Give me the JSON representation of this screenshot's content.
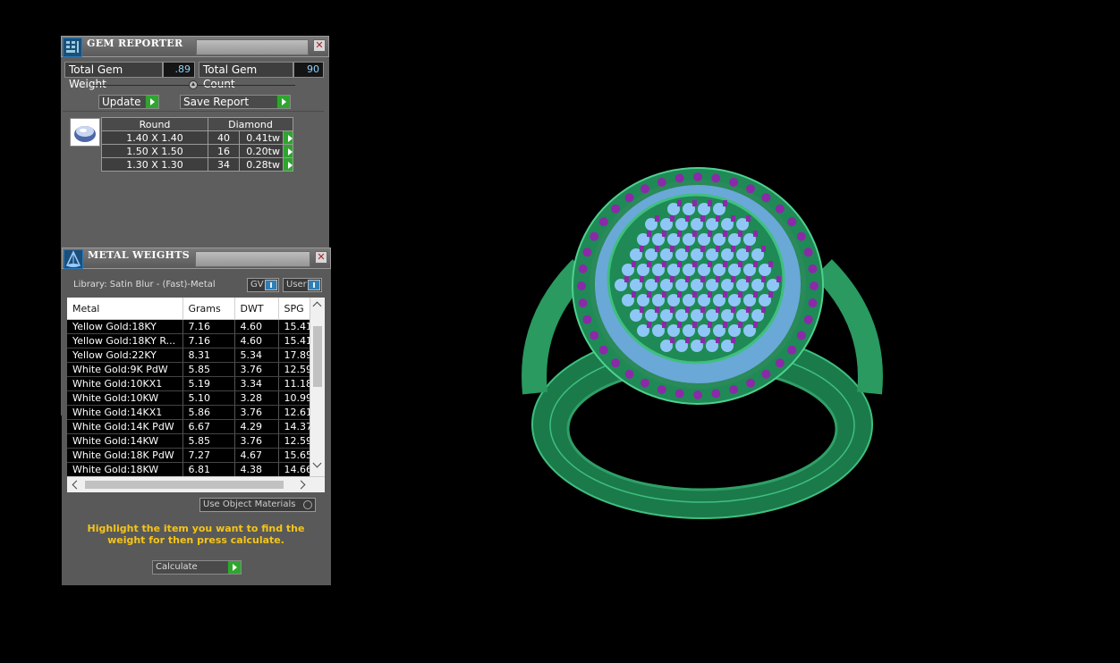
{
  "gem_reporter": {
    "title": "GEM REPORTER",
    "total_weight_label": "Total Gem Weight",
    "total_weight_value": ".89",
    "total_count_label": "Total Gem Count",
    "total_count_value": "90",
    "update_label": "Update",
    "save_report_label": "Save Report",
    "header": {
      "shape": "Round",
      "type": "Diamond"
    },
    "rows": [
      {
        "size": "1.40 X 1.40",
        "count": "40",
        "weight": "0.41tw"
      },
      {
        "size": "1.50 X 1.50",
        "count": "16",
        "weight": "0.20tw"
      },
      {
        "size": "1.30 X 1.30",
        "count": "34",
        "weight": "0.28tw"
      }
    ]
  },
  "metal_weights": {
    "title": "METAL WEIGHTS",
    "library": "Library: Satin Blur - (Fast)-Metal",
    "gv_label": "GV",
    "user_label": "User",
    "columns": [
      "Metal",
      "Grams",
      "DWT",
      "SPG"
    ],
    "rows": [
      {
        "metal": "Yellow Gold:18KY",
        "grams": "7.16",
        "dwt": "4.60",
        "spg": "15.41"
      },
      {
        "metal": "Yellow Gold:18KY R...",
        "grams": "7.16",
        "dwt": "4.60",
        "spg": "15.41"
      },
      {
        "metal": "Yellow Gold:22KY",
        "grams": "8.31",
        "dwt": "5.34",
        "spg": "17.89"
      },
      {
        "metal": "White Gold:9K PdW",
        "grams": "5.85",
        "dwt": "3.76",
        "spg": "12.59"
      },
      {
        "metal": "White Gold:10KX1",
        "grams": "5.19",
        "dwt": "3.34",
        "spg": "11.18"
      },
      {
        "metal": "White Gold:10KW",
        "grams": "5.10",
        "dwt": "3.28",
        "spg": "10.99"
      },
      {
        "metal": "White Gold:14KX1",
        "grams": "5.86",
        "dwt": "3.76",
        "spg": "12.61"
      },
      {
        "metal": "White Gold:14K PdW",
        "grams": "6.67",
        "dwt": "4.29",
        "spg": "14.37"
      },
      {
        "metal": "White Gold:14KW",
        "grams": "5.85",
        "dwt": "3.76",
        "spg": "12.59"
      },
      {
        "metal": "White Gold:18K PdW",
        "grams": "7.27",
        "dwt": "4.67",
        "spg": "15.65"
      },
      {
        "metal": "White Gold:18KW",
        "grams": "6.81",
        "dwt": "4.38",
        "spg": "14.66"
      }
    ],
    "use_object_materials_label": "Use Object Materials",
    "instruction": "Highlight the item you want to find the weight for then press calculate.",
    "calculate_label": "Calculate"
  },
  "colors": {
    "ring_green": "#1f8a55",
    "gem_blue": "#8ec7f5",
    "prong_purple": "#8a2aa8",
    "instruction_yellow": "#f5c518",
    "value_cyan": "#8cd3ff"
  }
}
